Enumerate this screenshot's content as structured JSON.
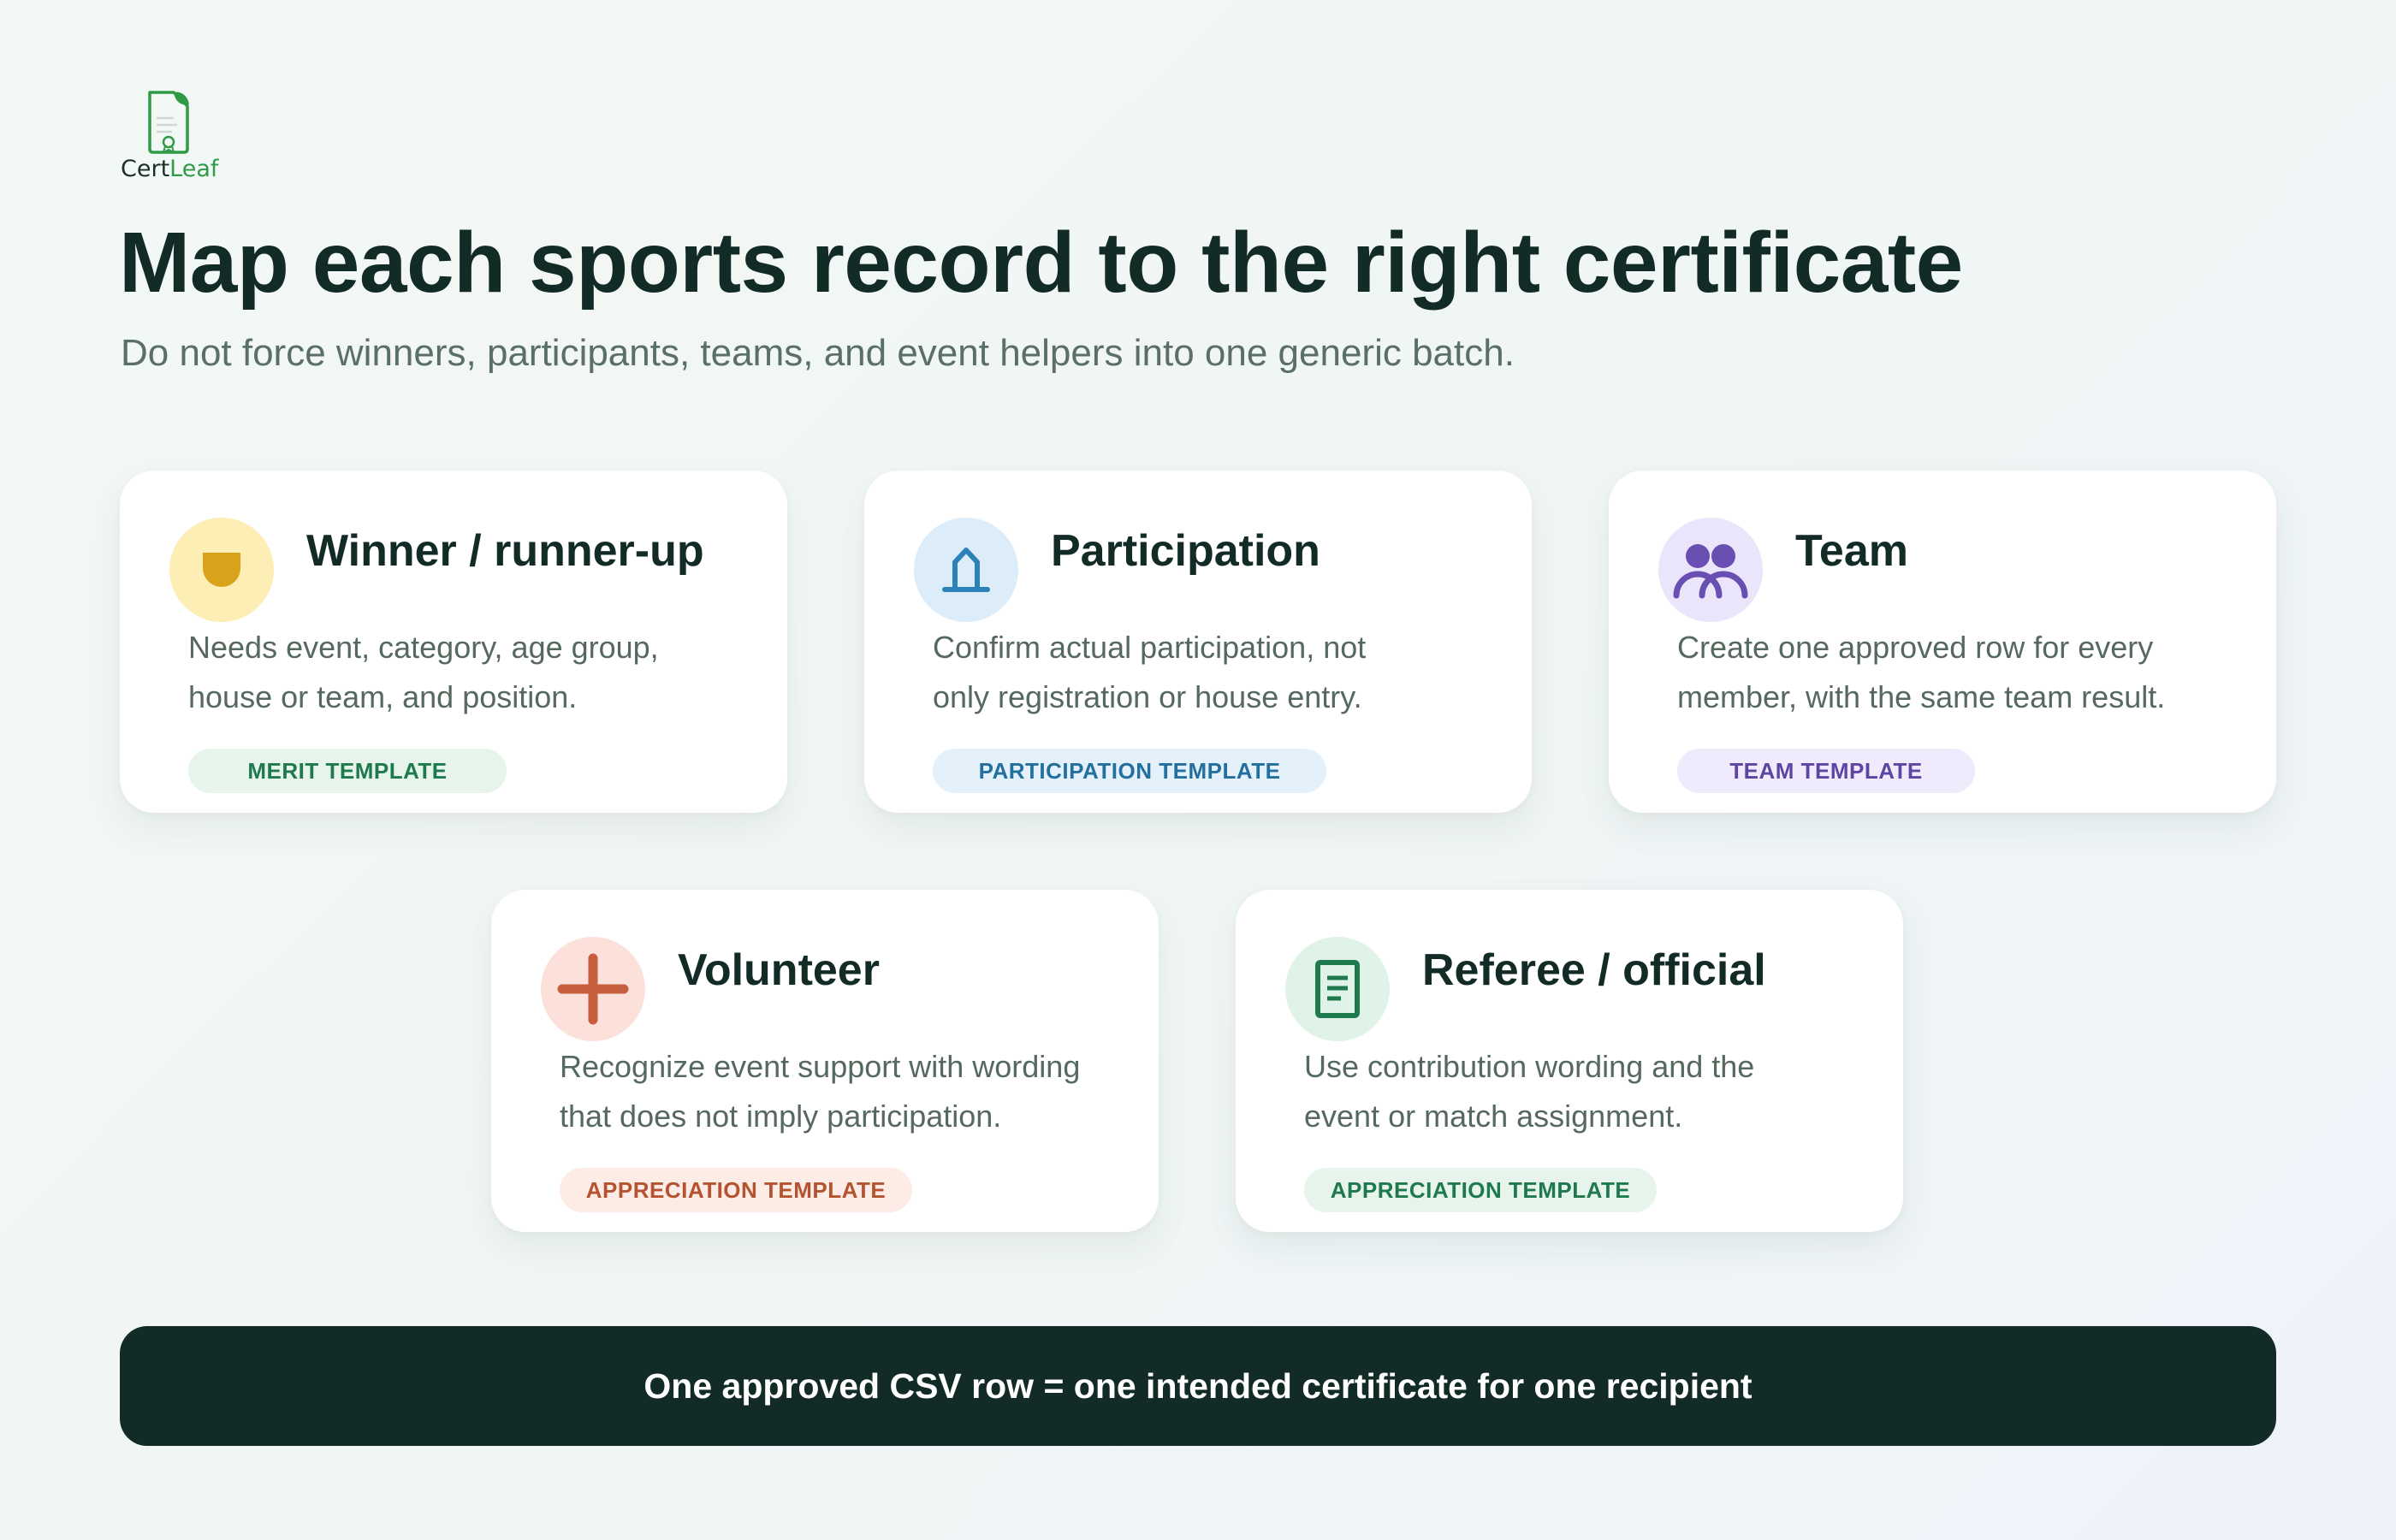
{
  "brand": {
    "name_part1": "Cert",
    "name_part2": "Leaf"
  },
  "header": {
    "title": "Map each sports record to the right certificate",
    "subtitle": "Do not force winners, participants, teams, and event helpers into one generic batch."
  },
  "cards": [
    {
      "title": "Winner / runner-up",
      "icon": "medal-icon",
      "desc_line1": "Needs event, category, age group,",
      "desc_line2": "house or team, and position.",
      "template": "MERIT TEMPLATE",
      "accent": "#d9a21b"
    },
    {
      "title": "Participation",
      "icon": "flag-icon",
      "desc_line1": "Confirm actual participation, not",
      "desc_line2": "only registration or house entry.",
      "template": "PARTICIPATION TEMPLATE",
      "accent": "#2b82b8"
    },
    {
      "title": "Team",
      "icon": "team-icon",
      "desc_line1": "Create one approved row for every",
      "desc_line2": "member, with the same team result.",
      "template": "TEAM TEMPLATE",
      "accent": "#6a4fb3"
    },
    {
      "title": "Volunteer",
      "icon": "plus-icon",
      "desc_line1": "Recognize event support with wording",
      "desc_line2": "that does not imply participation.",
      "template": "APPRECIATION TEMPLATE",
      "accent": "#c75e3e"
    },
    {
      "title": "Referee / official",
      "icon": "document-icon",
      "desc_line1": "Use contribution wording and the",
      "desc_line2": "event or match assignment.",
      "template": "APPRECIATION TEMPLATE",
      "accent": "#1e7a4d"
    }
  ],
  "banner": {
    "text": "One approved CSV row = one intended certificate for one recipient"
  }
}
